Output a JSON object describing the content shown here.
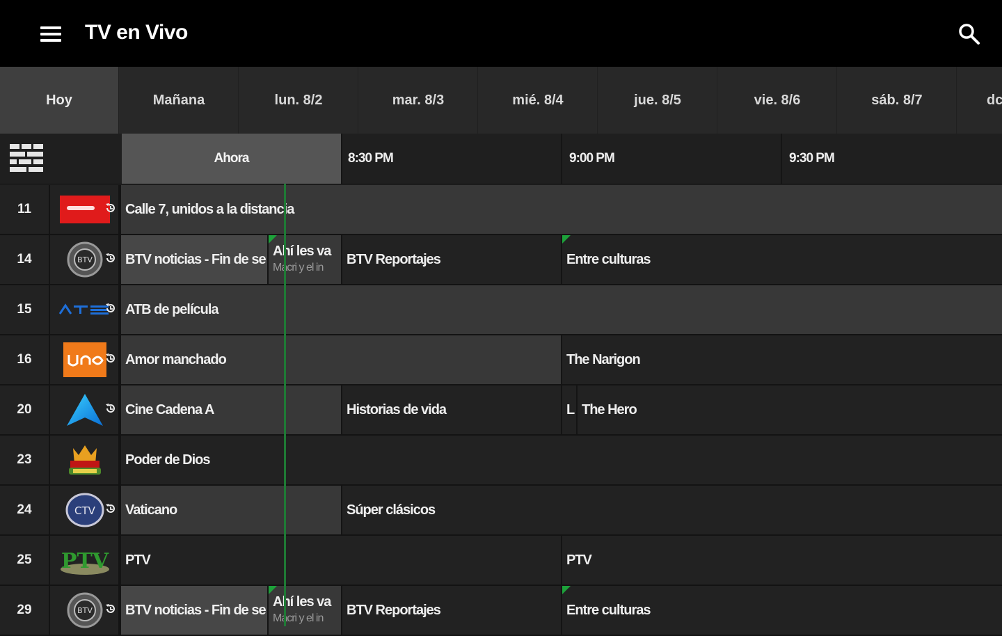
{
  "app": {
    "title": "TV en Vivo",
    "menu_icon": "menu-icon",
    "search_icon": "search-icon"
  },
  "days": [
    "Hoy",
    "Mañana",
    "lun. 8/2",
    "mar. 8/3",
    "mié. 8/4",
    "jue. 8/5",
    "vie. 8/6",
    "sáb. 8/7",
    "dc"
  ],
  "selected_day": "Hoy",
  "times": {
    "now": "Ahora",
    "t1": "8:30 PM",
    "t2": "9:00 PM",
    "t3": "9:30 PM"
  },
  "channels": [
    {
      "number": "11",
      "logo": "red-logo",
      "replay": true,
      "programs": [
        {
          "title": "Calle 7, unidos a la distancia"
        }
      ]
    },
    {
      "number": "14",
      "logo": "btv-logo",
      "replay": true,
      "programs": [
        {
          "title": "BTV noticias - Fin de se"
        },
        {
          "title": "Ahí les va",
          "subtitle": "Macri y el in"
        },
        {
          "title": "BTV Reportajes"
        },
        {
          "title": "Entre culturas"
        }
      ]
    },
    {
      "number": "15",
      "logo": "atb-logo",
      "replay": true,
      "programs": [
        {
          "title": "ATB de película"
        }
      ]
    },
    {
      "number": "16",
      "logo": "uno-logo",
      "replay": true,
      "programs": [
        {
          "title": "Amor manchado"
        },
        {
          "title": "The Narigon"
        }
      ]
    },
    {
      "number": "20",
      "logo": "cadena-a-logo",
      "replay": true,
      "programs": [
        {
          "title": "Cine Cadena A"
        },
        {
          "title": "Historias de vida"
        },
        {
          "title": "L"
        },
        {
          "title": "The Hero"
        }
      ]
    },
    {
      "number": "23",
      "logo": "poder-de-dios-logo",
      "replay": false,
      "programs": [
        {
          "title": "Poder de Dios"
        }
      ]
    },
    {
      "number": "24",
      "logo": "ctv-logo",
      "replay": true,
      "programs": [
        {
          "title": "Vaticano"
        },
        {
          "title": "Súper clásicos"
        }
      ]
    },
    {
      "number": "25",
      "logo": "ptv-logo",
      "replay": false,
      "programs": [
        {
          "title": "PTV"
        },
        {
          "title": "PTV"
        }
      ]
    },
    {
      "number": "29",
      "logo": "btv-logo",
      "replay": true,
      "programs": [
        {
          "title": "BTV noticias - Fin de se"
        },
        {
          "title": "Ahí les va",
          "subtitle": "Macri y el in"
        },
        {
          "title": "BTV Reportajes"
        },
        {
          "title": "Entre culturas"
        }
      ]
    }
  ],
  "colors": {
    "appbar": "#000000",
    "background": "#1e1e1e",
    "now_line": "#1f7a35",
    "new_flag": "#1da23a",
    "active_tab": "#3f3f3f",
    "now_header": "#555555"
  }
}
